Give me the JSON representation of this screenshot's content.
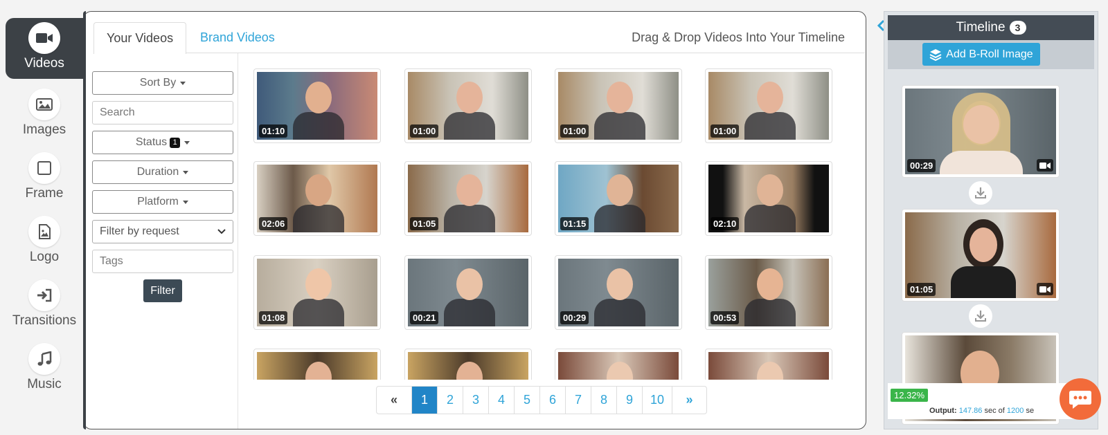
{
  "nav": {
    "items": [
      {
        "label": "Videos",
        "icon": "video-camera-icon"
      },
      {
        "label": "Images",
        "icon": "image-icon"
      },
      {
        "label": "Frame",
        "icon": "square-icon"
      },
      {
        "label": "Logo",
        "icon": "file-image-icon"
      },
      {
        "label": "Transitions",
        "icon": "sign-in-arrow-icon"
      },
      {
        "label": "Music",
        "icon": "music-note-icon"
      }
    ]
  },
  "tabs": {
    "your_videos": "Your Videos",
    "brand_videos": "Brand Videos"
  },
  "instruction": "Drag & Drop Videos Into Your Timeline",
  "filters": {
    "sort_by": "Sort By",
    "search_placeholder": "Search",
    "status": "Status",
    "status_count": "1",
    "duration": "Duration",
    "platform": "Platform",
    "request_select": "Filter by request",
    "tags_placeholder": "Tags",
    "filter_button": "Filter"
  },
  "videos": [
    {
      "duration": "01:10"
    },
    {
      "duration": "01:00"
    },
    {
      "duration": "01:00"
    },
    {
      "duration": "01:00"
    },
    {
      "duration": "02:06"
    },
    {
      "duration": "01:05"
    },
    {
      "duration": "01:15"
    },
    {
      "duration": "02:10"
    },
    {
      "duration": "01:08"
    },
    {
      "duration": "00:21"
    },
    {
      "duration": "00:29"
    },
    {
      "duration": "00:53"
    },
    {
      "duration": ""
    },
    {
      "duration": ""
    },
    {
      "duration": ""
    },
    {
      "duration": ""
    }
  ],
  "pagination": {
    "prev": "«",
    "next": "»",
    "pages": [
      "1",
      "2",
      "3",
      "4",
      "5",
      "6",
      "7",
      "8",
      "9",
      "10"
    ],
    "current": "1"
  },
  "timeline": {
    "title": "Timeline",
    "count": "3",
    "add_broll": "Add B-Roll Image",
    "clips": [
      {
        "duration": "00:29"
      },
      {
        "duration": "01:05"
      },
      {
        "duration": ""
      }
    ],
    "progress": "12.32%",
    "output_label": "Output:",
    "output_used": "147.86",
    "output_mid": "sec of",
    "output_total": "1200",
    "output_unit": "se"
  },
  "colors": {
    "accent": "#2fa4d8",
    "dark": "#3c4146",
    "progress_green": "#3ab54a",
    "chat": "#f26b3a"
  }
}
